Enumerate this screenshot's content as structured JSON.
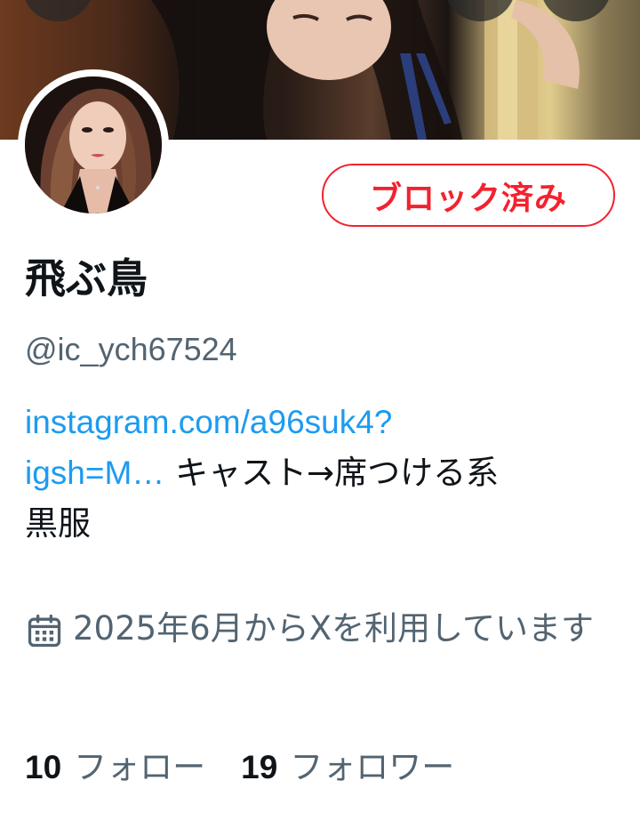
{
  "header": {
    "back_icon": "arrow-left-icon",
    "search_icon": "search-icon",
    "more_icon": "more-icon"
  },
  "profile": {
    "display_name": "飛ぶ鳥",
    "handle": "@ic_ych67524",
    "blocked_label": "ブロック済み",
    "bio": {
      "link_text_line1": "instagram.com/a96suk4?",
      "link_text_line2": "igsh=M…",
      "text_after_link": "キャスト→席つける系",
      "text_line3": "黒服"
    },
    "joined": "2025年6月からXを利用しています",
    "following_count": "10",
    "following_label": "フォロー",
    "followers_count": "19",
    "followers_label": "フォロワー"
  },
  "colors": {
    "accent_link": "#1d9bf0",
    "blocked_red": "#f4212e",
    "secondary_text": "#536471",
    "primary_text": "#0f1419"
  }
}
